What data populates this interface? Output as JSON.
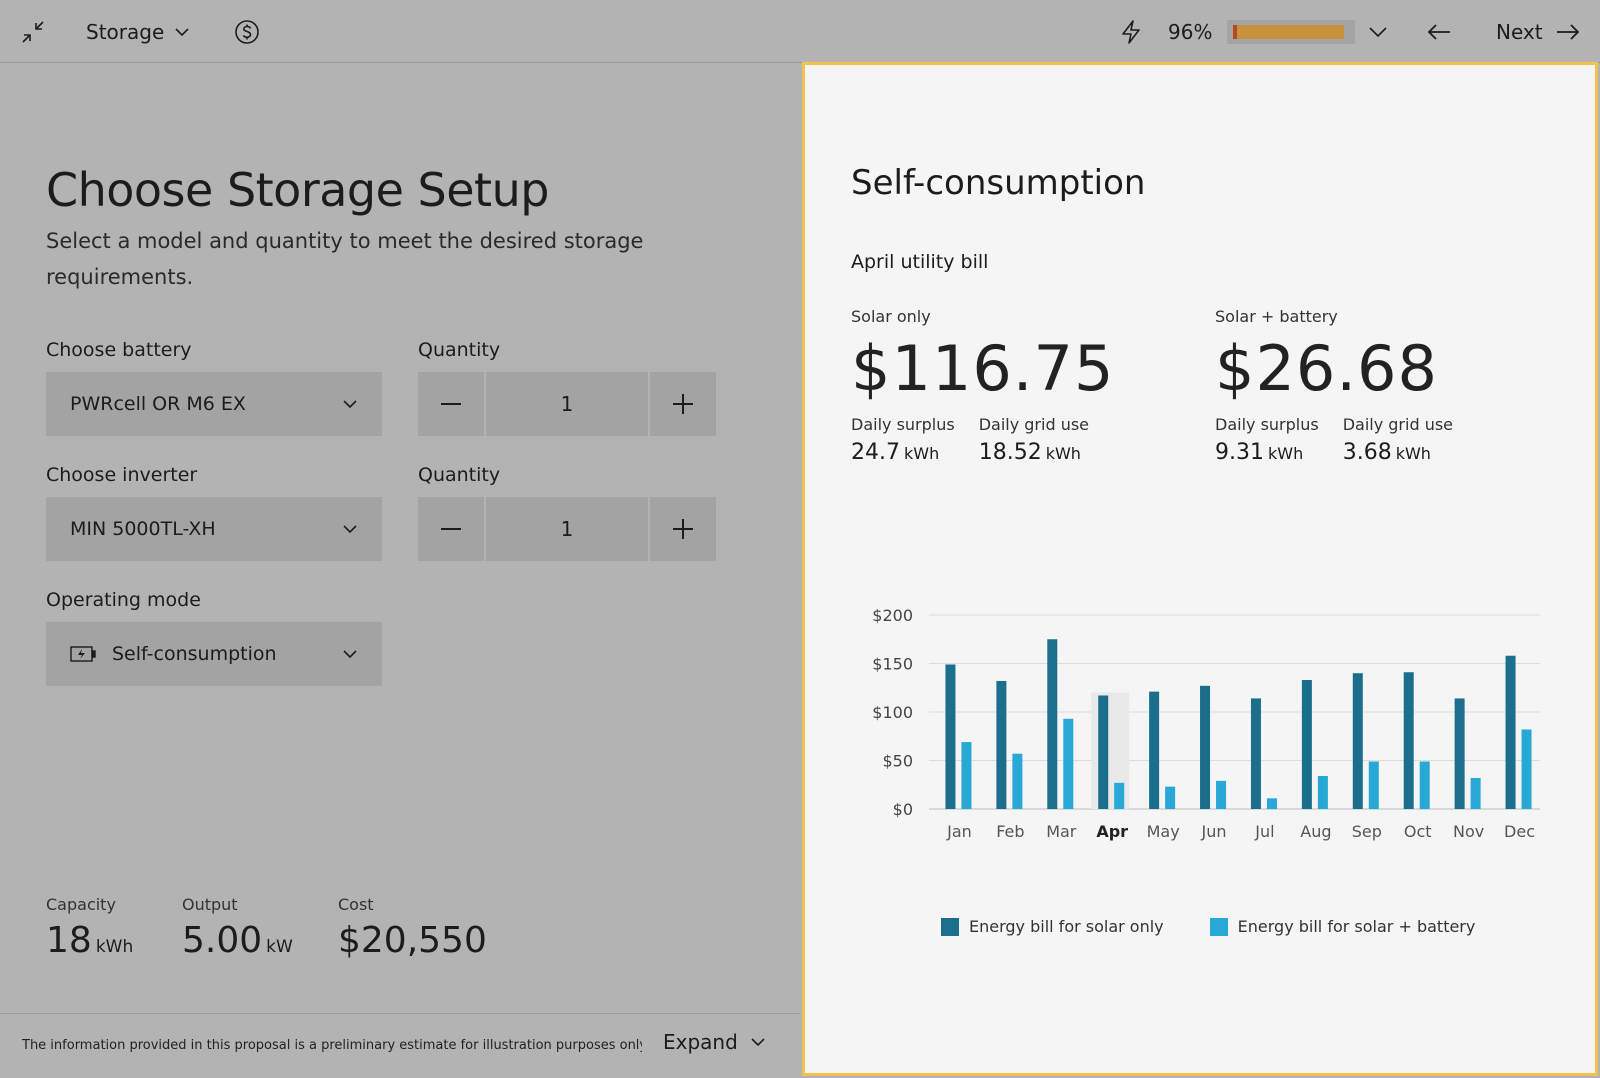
{
  "topbar": {
    "section_label": "Storage",
    "progress_text": "96%",
    "progress_value": 0.96,
    "next_label": "Next"
  },
  "left": {
    "title": "Choose Storage Setup",
    "subtitle": "Select a model and quantity to meet the desired storage requirements.",
    "battery": {
      "label": "Choose battery",
      "value": "PWRcell OR M6 EX"
    },
    "battery_qty": {
      "label": "Quantity",
      "value": "1"
    },
    "inverter": {
      "label": "Choose inverter",
      "value": "MIN 5000TL-XH"
    },
    "inverter_qty": {
      "label": "Quantity",
      "value": "1"
    },
    "mode": {
      "label": "Operating mode",
      "value": "Self-consumption"
    },
    "stats": {
      "capacity": {
        "label": "Capacity",
        "value": "18",
        "unit": "kWh"
      },
      "output": {
        "label": "Output",
        "value": "5.00",
        "unit": "kW"
      },
      "cost": {
        "label": "Cost",
        "value": "$20,550"
      }
    },
    "footer": {
      "text": "The information provided in this proposal is a preliminary estimate for illustration purposes only...",
      "expand_label": "Expand"
    }
  },
  "right": {
    "title": "Self-consumption",
    "subtitle": "April utility bill",
    "solar_only": {
      "label": "Solar only",
      "value": "$116.75",
      "surplus_label": "Daily surplus",
      "surplus_value": "24.7",
      "grid_label": "Daily grid use",
      "grid_value": "18.52",
      "unit": "kWh"
    },
    "solar_battery": {
      "label": "Solar + battery",
      "value": "$26.68",
      "surplus_label": "Daily surplus",
      "surplus_value": "9.31",
      "grid_label": "Daily grid use",
      "grid_value": "3.68",
      "unit": "kWh"
    }
  },
  "colors": {
    "accent_border": "#f3c14e",
    "series_solar": "#1c6f8c",
    "series_battery": "#27a8d6",
    "progress_fill": "#c8903a"
  },
  "chart_data": {
    "type": "bar",
    "categories": [
      "Jan",
      "Feb",
      "Mar",
      "Apr",
      "May",
      "Jun",
      "Jul",
      "Aug",
      "Sep",
      "Oct",
      "Nov",
      "Dec"
    ],
    "highlight": "Apr",
    "y_ticks": [
      "$0",
      "$50",
      "$100",
      "$150",
      "$200"
    ],
    "ylim": [
      0,
      200
    ],
    "grid": true,
    "legend_position": "bottom",
    "series": [
      {
        "name": "Energy bill for solar only",
        "color": "#1c6f8c",
        "values": [
          149,
          132,
          175,
          117,
          121,
          127,
          114,
          133,
          140,
          141,
          114,
          158
        ]
      },
      {
        "name": "Energy bill for solar + battery",
        "color": "#27a8d6",
        "values": [
          69,
          57,
          93,
          27,
          23,
          29,
          11,
          34,
          49,
          49,
          32,
          82
        ]
      }
    ]
  }
}
